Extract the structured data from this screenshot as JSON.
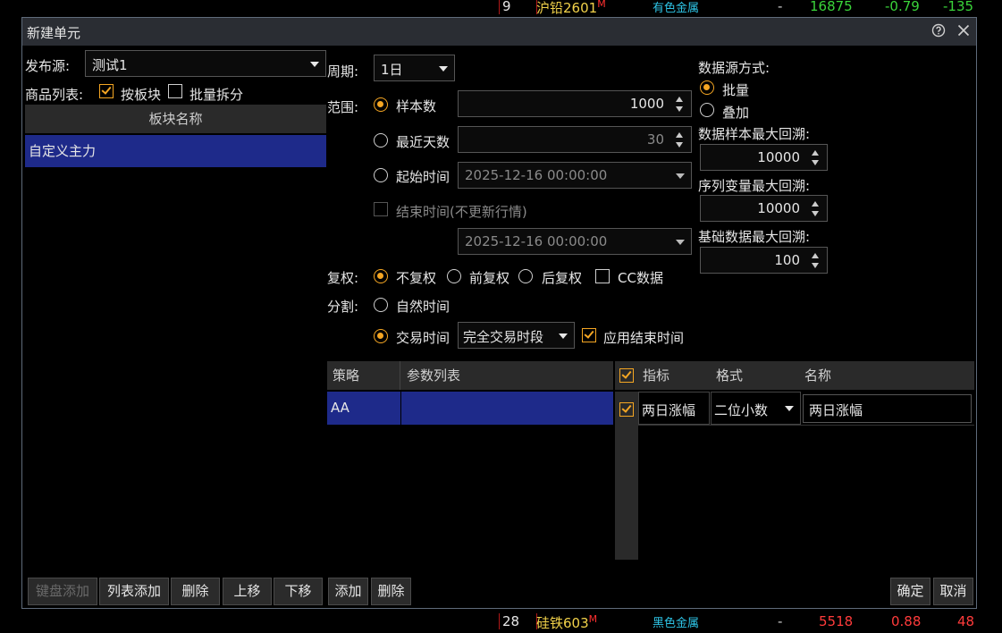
{
  "background_quotes": [
    {
      "index": "9",
      "name": "沪铅2601",
      "marker": "M",
      "sector": "有色金属",
      "dash": "-",
      "price": "16875",
      "change": "-0.79",
      "amount": "-135",
      "color": "#3ad43a"
    },
    {
      "index": "28",
      "name": "硅铁603",
      "marker": "M",
      "sector": "黑色金属",
      "dash": "-",
      "price": "5518",
      "change": "0.88",
      "amount": "48",
      "color": "#ff3b3b"
    }
  ],
  "dialog": {
    "title": "新建单元",
    "help_icon": "question-circle-icon",
    "close_icon": "close-icon"
  },
  "left": {
    "publisher_label": "发布源:",
    "publisher_value": "测试1",
    "product_list_label": "商品列表:",
    "by_sector_label": "按板块",
    "by_sector_checked": true,
    "batch_split_label": "批量拆分",
    "batch_split_checked": false,
    "table_header": "板块名称",
    "rows": [
      "自定义主力"
    ]
  },
  "middle": {
    "period_label": "周期:",
    "period_value": "1日",
    "range_label": "范围:",
    "sample_count_label": "样本数",
    "sample_count_value": "1000",
    "recent_days_label": "最近天数",
    "recent_days_value": "30",
    "start_time_label": "起始时间",
    "start_time_value": "2025-12-16 00:00:00",
    "end_time_label": "结束时间(不更新行情)",
    "end_time_value": "2025-12-16 00:00:00",
    "adjust_label": "复权:",
    "no_adjust_label": "不复权",
    "pre_adjust_label": "前复权",
    "post_adjust_label": "后复权",
    "cc_data_label": "CC数据",
    "split_label": "分割:",
    "natural_time_label": "自然时间",
    "trading_time_label": "交易时间",
    "trading_period_value": "完全交易时段",
    "apply_end_time_label": "应用结束时间"
  },
  "right": {
    "source_mode_label": "数据源方式:",
    "batch_label": "批量",
    "overlay_label": "叠加",
    "max_sample_label": "数据样本最大回溯:",
    "max_sample_value": "10000",
    "max_series_label": "序列变量最大回溯:",
    "max_series_value": "10000",
    "max_base_label": "基础数据最大回溯:",
    "max_base_value": "100"
  },
  "strategy_table": {
    "col_strategy": "策略",
    "col_params": "参数列表",
    "rows": [
      {
        "strategy": "AA",
        "params": ""
      }
    ]
  },
  "indicator_table": {
    "col_indicator": "指标",
    "col_format": "格式",
    "col_name": "名称",
    "rows": [
      {
        "indicator": "两日涨幅",
        "format": "二位小数",
        "name": "两日涨幅",
        "checked": true
      }
    ]
  },
  "buttons": {
    "keyboard_add": "键盘添加",
    "list_add": "列表添加",
    "delete": "删除",
    "move_up": "上移",
    "move_down": "下移",
    "add": "添加",
    "delete2": "删除",
    "ok": "确定",
    "cancel": "取消"
  },
  "colors": {
    "accent": "#f5a623",
    "selection": "#1e2a8a",
    "header_bg": "#2a2a2a"
  }
}
